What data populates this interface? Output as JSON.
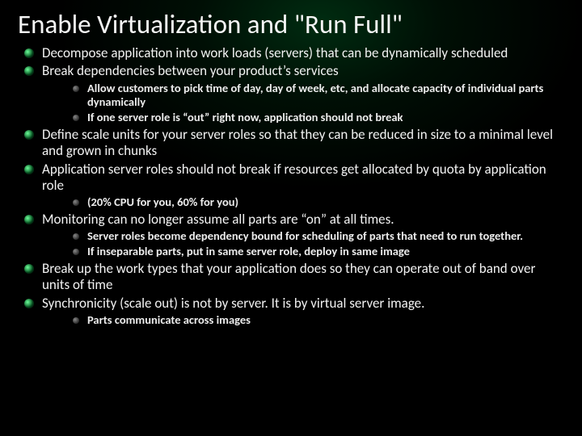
{
  "title": "Enable Virtualization and \"Run Full\"",
  "b1": "Decompose application into work loads (servers) that can be dynamically scheduled",
  "b2": "Break dependencies between your product’s services",
  "b2s1": "Allow customers to pick time of day, day of week, etc, and allocate capacity of individual parts dynamically",
  "b2s2": "If one server role is “out” right now, application should not break",
  "b3": "Define scale units for your server roles so that they can be reduced in size to a minimal level and grown in chunks",
  "b4": "Application server roles should not break if resources get allocated by quota by application role",
  "b4s1": "(20% CPU for you, 60% for you)",
  "b5": "Monitoring can no longer assume all parts are “on” at all times.",
  "b5s1": "Server roles become dependency bound for scheduling of parts that need to run together.",
  "b5s2": "If inseparable parts, put in same server role, deploy in same image",
  "b6": "Break up the work types that your application does so they can operate out of band over units of time",
  "b7": "Synchronicity (scale out) is not by server.  It is by virtual server image.",
  "b7s1": "Parts communicate across images"
}
